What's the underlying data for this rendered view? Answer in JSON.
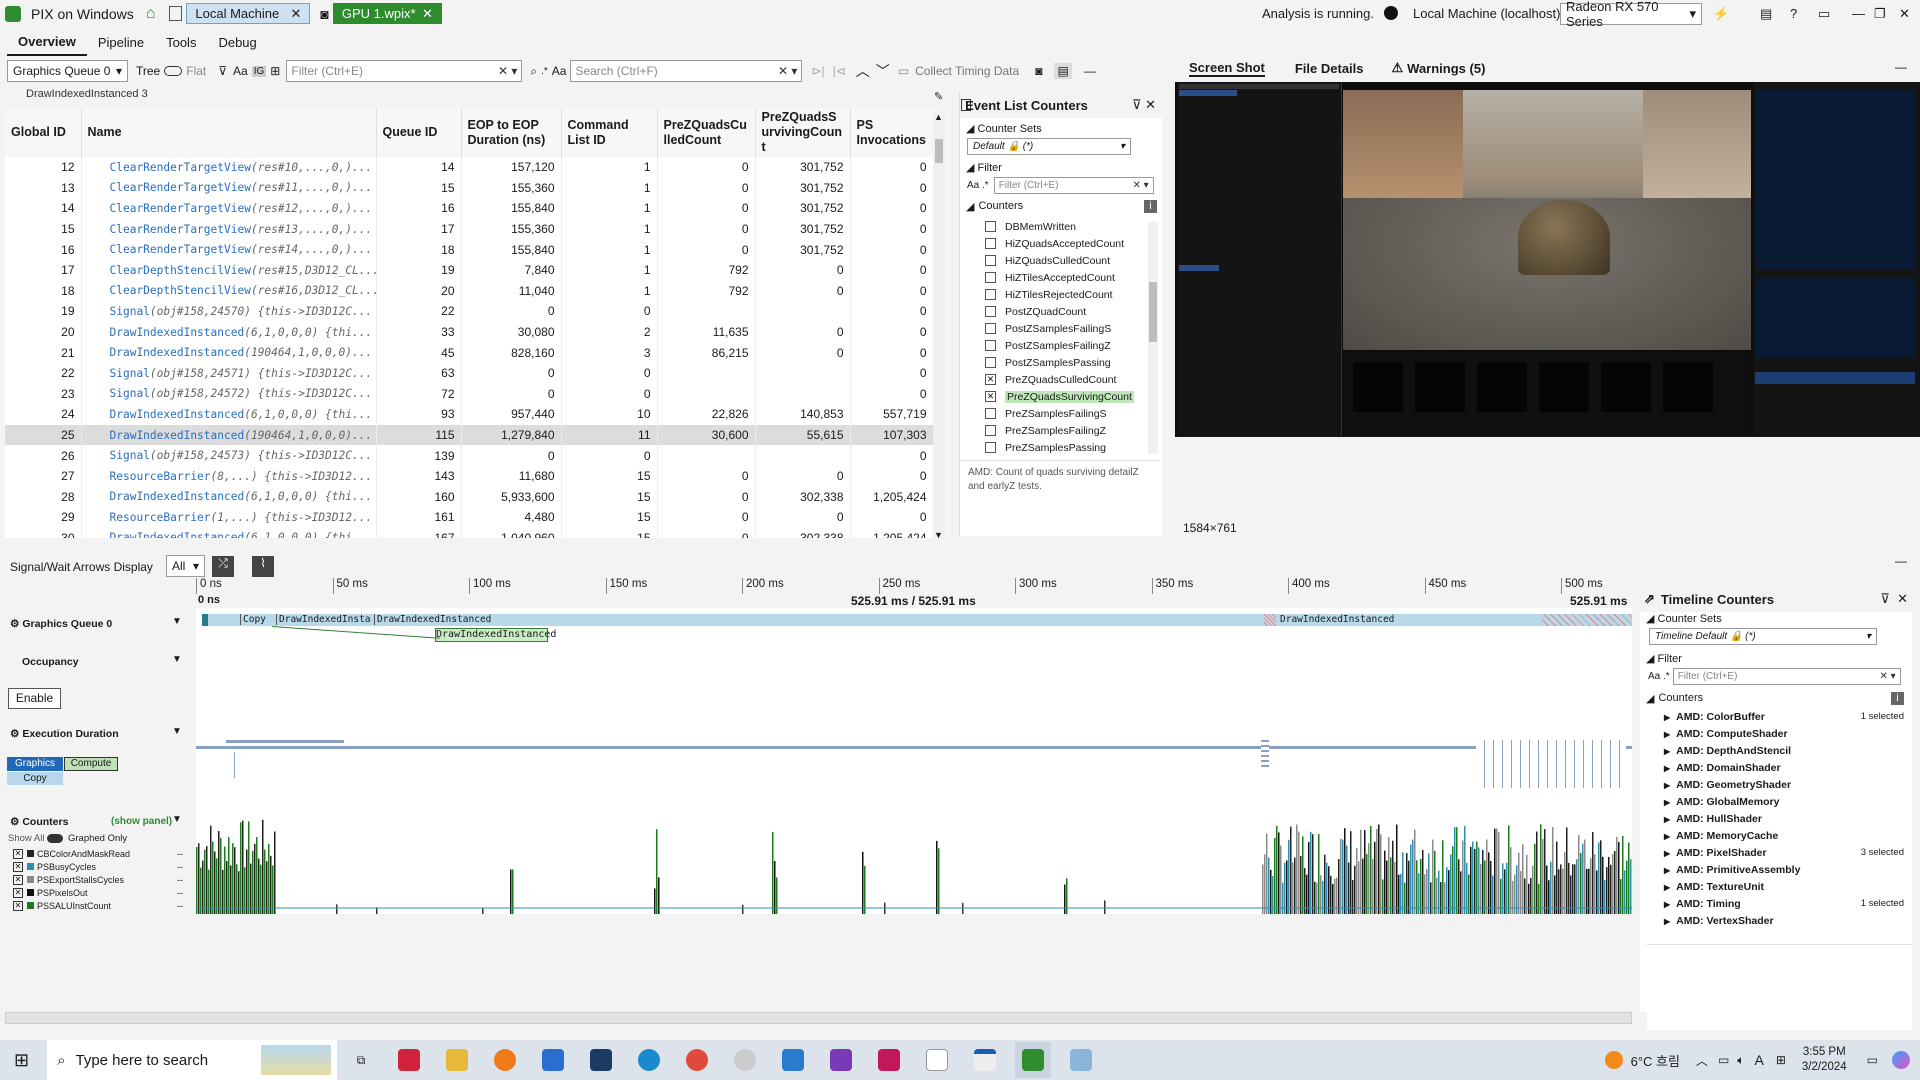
{
  "app": {
    "title": "PIX on Windows",
    "tabs": [
      {
        "label": "Local Machine"
      },
      {
        "label": "GPU 1.wpix*"
      }
    ],
    "status": "Analysis is running.",
    "machine": "Local Machine (localhost)",
    "gpu": "Radeon RX 570 Series"
  },
  "menu": [
    {
      "label": "Overview"
    },
    {
      "label": "Pipeline"
    },
    {
      "label": "Tools"
    },
    {
      "label": "Debug"
    }
  ],
  "toolbar": {
    "queue": "Graphics Queue 0",
    "tree": "Tree",
    "flat": "Flat",
    "aa": "Aa",
    "filter_placeholder": "Filter (Ctrl+E)",
    "search_placeholder": "Search (Ctrl+F)",
    "collect": "Collect Timing Data"
  },
  "breadcrumb": "DrawIndexedInstanced 3",
  "grid": {
    "columns": [
      "Global ID",
      "Name",
      "Queue ID",
      "EOP to EOP Duration (ns)",
      "Command List ID",
      "PreZQuadsCulledCount",
      "PreZQuadsSurvivingCount",
      "PS Invocations"
    ],
    "rows": [
      {
        "gid": "12",
        "fn": "ClearRenderTargetView",
        "args": "(res#10,...,0,)...",
        "qid": "14",
        "eop": "157,120",
        "cl": "1",
        "culled": "0",
        "surv": "301,752",
        "ps": "0"
      },
      {
        "gid": "13",
        "fn": "ClearRenderTargetView",
        "args": "(res#11,...,0,)...",
        "qid": "15",
        "eop": "155,360",
        "cl": "1",
        "culled": "0",
        "surv": "301,752",
        "ps": "0"
      },
      {
        "gid": "14",
        "fn": "ClearRenderTargetView",
        "args": "(res#12,...,0,)...",
        "qid": "16",
        "eop": "155,840",
        "cl": "1",
        "culled": "0",
        "surv": "301,752",
        "ps": "0"
      },
      {
        "gid": "15",
        "fn": "ClearRenderTargetView",
        "args": "(res#13,...,0,)...",
        "qid": "17",
        "eop": "155,360",
        "cl": "1",
        "culled": "0",
        "surv": "301,752",
        "ps": "0"
      },
      {
        "gid": "16",
        "fn": "ClearRenderTargetView",
        "args": "(res#14,...,0,)...",
        "qid": "18",
        "eop": "155,840",
        "cl": "1",
        "culled": "0",
        "surv": "301,752",
        "ps": "0"
      },
      {
        "gid": "17",
        "fn": "ClearDepthStencilView",
        "args": "(res#15,D3D12_CL...",
        "qid": "19",
        "eop": "7,840",
        "cl": "1",
        "culled": "792",
        "surv": "0",
        "ps": "0"
      },
      {
        "gid": "18",
        "fn": "ClearDepthStencilView",
        "args": "(res#16,D3D12_CL...",
        "qid": "20",
        "eop": "11,040",
        "cl": "1",
        "culled": "792",
        "surv": "0",
        "ps": "0"
      },
      {
        "gid": "19",
        "fn": "Signal",
        "args": "(obj#158,24570)  {this->ID3D12C...",
        "qid": "22",
        "eop": "0",
        "cl": "0",
        "culled": "",
        "surv": "",
        "ps": "0"
      },
      {
        "gid": "20",
        "fn": "DrawIndexedInstanced",
        "args": "(6,1,0,0,0)  {thi...",
        "qid": "33",
        "eop": "30,080",
        "cl": "2",
        "culled": "11,635",
        "surv": "0",
        "ps": "0"
      },
      {
        "gid": "21",
        "fn": "DrawIndexedInstanced",
        "args": "(190464,1,0,0,0)...",
        "qid": "45",
        "eop": "828,160",
        "cl": "3",
        "culled": "86,215",
        "surv": "0",
        "ps": "0"
      },
      {
        "gid": "22",
        "fn": "Signal",
        "args": "(obj#158,24571)  {this->ID3D12C...",
        "qid": "63",
        "eop": "0",
        "cl": "0",
        "culled": "",
        "surv": "",
        "ps": "0"
      },
      {
        "gid": "23",
        "fn": "Signal",
        "args": "(obj#158,24572)  {this->ID3D12C...",
        "qid": "72",
        "eop": "0",
        "cl": "0",
        "culled": "",
        "surv": "",
        "ps": "0"
      },
      {
        "gid": "24",
        "fn": "DrawIndexedInstanced",
        "args": "(6,1,0,0,0)  {thi...",
        "qid": "93",
        "eop": "957,440",
        "cl": "10",
        "culled": "22,826",
        "surv": "140,853",
        "ps": "557,719"
      },
      {
        "gid": "25",
        "fn": "DrawIndexedInstanced",
        "args": "(190464,1,0,0,0)...",
        "qid": "115",
        "eop": "1,279,840",
        "cl": "11",
        "culled": "30,600",
        "surv": "55,615",
        "ps": "107,303",
        "selected": true
      },
      {
        "gid": "26",
        "fn": "Signal",
        "args": "(obj#158,24573)  {this->ID3D12C...",
        "qid": "139",
        "eop": "0",
        "cl": "0",
        "culled": "",
        "surv": "",
        "ps": "0"
      },
      {
        "gid": "27",
        "fn": "ResourceBarrier",
        "args": "(8,...)  {this->ID3D12...",
        "qid": "143",
        "eop": "11,680",
        "cl": "15",
        "culled": "0",
        "surv": "0",
        "ps": "0"
      },
      {
        "gid": "28",
        "fn": "DrawIndexedInstanced",
        "args": "(6,1,0,0,0)  {thi...",
        "qid": "160",
        "eop": "5,933,600",
        "cl": "15",
        "culled": "0",
        "surv": "302,338",
        "ps": "1,205,424"
      },
      {
        "gid": "29",
        "fn": "ResourceBarrier",
        "args": "(1,...)  {this->ID3D12...",
        "qid": "161",
        "eop": "4,480",
        "cl": "15",
        "culled": "0",
        "surv": "0",
        "ps": "0"
      },
      {
        "gid": "30",
        "fn": "DrawIndexedInstanced",
        "args": "(6,1,0,0,0)  {thi...",
        "qid": "167",
        "eop": "1,040,960",
        "cl": "15",
        "culled": "0",
        "surv": "302,338",
        "ps": "1,205,424"
      }
    ]
  },
  "event_counters": {
    "title": "Event List Counters",
    "counter_sets_label": "Counter Sets",
    "counter_set": "Default 🔒 (*)",
    "filter_label": "Filter",
    "filter_placeholder": "Filter (Ctrl+E)",
    "counters_label": "Counters",
    "items": [
      {
        "name": "DBMemWritten",
        "checked": false
      },
      {
        "name": "HiZQuadsAcceptedCount",
        "checked": false
      },
      {
        "name": "HiZQuadsCulledCount",
        "checked": false
      },
      {
        "name": "HiZTilesAcceptedCount",
        "checked": false
      },
      {
        "name": "HiZTilesRejectedCount",
        "checked": false
      },
      {
        "name": "PostZQuadCount",
        "checked": false
      },
      {
        "name": "PostZSamplesFailingS",
        "checked": false
      },
      {
        "name": "PostZSamplesFailingZ",
        "checked": false
      },
      {
        "name": "PostZSamplesPassing",
        "checked": false
      },
      {
        "name": "PreZQuadsCulledCount",
        "checked": true
      },
      {
        "name": "PreZQuadsSurvivingCount",
        "checked": true,
        "highlight": true
      },
      {
        "name": "PreZSamplesFailingS",
        "checked": false
      },
      {
        "name": "PreZSamplesFailingZ",
        "checked": false
      },
      {
        "name": "PreZSamplesPassing",
        "checked": false
      }
    ],
    "description": "AMD: Count of quads surviving detailZ and earlyZ tests."
  },
  "right_tabs": [
    {
      "label": "Screen Shot"
    },
    {
      "label": "File Details"
    },
    {
      "label": "Warnings (5)"
    }
  ],
  "screenshot": {
    "size": "1584×761"
  },
  "timeline": {
    "arrows_label": "Signal/Wait Arrows Display",
    "arrows_value": "All",
    "ticks": [
      "0 ns",
      "50 ms",
      "100 ms",
      "150 ms",
      "200 ms",
      "250 ms",
      "300 ms",
      "350 ms",
      "400 ms",
      "450 ms",
      "500 ms"
    ],
    "range_start": "0 ns",
    "range_mid": "525.91 ms / 525.91 ms",
    "range_end": "525.91 ms",
    "queue_label": "Graphics Queue 0",
    "occupancy_label": "Occupancy",
    "enable_label": "Enable",
    "exec_label": "Execution Duration",
    "graphics": "Graphics",
    "compute": "Compute",
    "copy": "Copy",
    "counters_label": "Counters",
    "show_panel": "(show panel)",
    "show_all": "Show All",
    "graphed_only": "Graphed Only",
    "bar_labels": [
      "Copy",
      "DrawIndexedInsta",
      "DrawIndexedInstanced",
      "DrawIndexedInstanced"
    ],
    "tooltip": "DrawIndexedInstanced",
    "counter_items": [
      {
        "name": "CBColorAndMaskRead",
        "color": "#222222"
      },
      {
        "name": "PSBusyCycles",
        "color": "#2d8fb0"
      },
      {
        "name": "PSExportStallsCycles",
        "color": "#8a8a8a"
      },
      {
        "name": "PSPixelsOut",
        "color": "#111111"
      },
      {
        "name": "PSSALUInstCount",
        "color": "#1d7a1d"
      }
    ],
    "dash": "--"
  },
  "timeline_counters": {
    "title": "Timeline Counters",
    "counter_sets_label": "Counter Sets",
    "counter_set": "Timeline Default 🔒 (*)",
    "filter_label": "Filter",
    "filter_placeholder": "Filter (Ctrl+E)",
    "counters_label": "Counters",
    "groups": [
      {
        "name": "AMD: ColorBuffer",
        "sel": "1 selected"
      },
      {
        "name": "AMD: ComputeShader",
        "sel": ""
      },
      {
        "name": "AMD: DepthAndStencil",
        "sel": ""
      },
      {
        "name": "AMD: DomainShader",
        "sel": ""
      },
      {
        "name": "AMD: GeometryShader",
        "sel": ""
      },
      {
        "name": "AMD: GlobalMemory",
        "sel": ""
      },
      {
        "name": "AMD: HullShader",
        "sel": ""
      },
      {
        "name": "AMD: MemoryCache",
        "sel": ""
      },
      {
        "name": "AMD: PixelShader",
        "sel": "3 selected"
      },
      {
        "name": "AMD: PrimitiveAssembly",
        "sel": ""
      },
      {
        "name": "AMD: TextureUnit",
        "sel": ""
      },
      {
        "name": "AMD: Timing",
        "sel": "1 selected"
      },
      {
        "name": "AMD: VertexShader",
        "sel": ""
      }
    ]
  },
  "taskbar": {
    "search": "Type here to search",
    "temp": "6°C 흐림",
    "time": "3:55 PM",
    "date": "3/2/2024",
    "lang": "A"
  }
}
